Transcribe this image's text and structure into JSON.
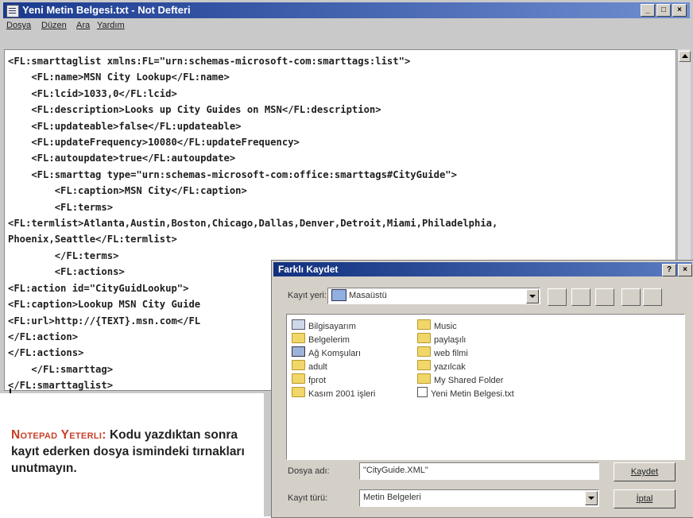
{
  "notepad": {
    "title": "Yeni Metin Belgesi.txt - Not Defteri",
    "menu": [
      "Dosya",
      "Düzen",
      "Ara",
      "Yardım"
    ],
    "code_lines": [
      "<FL:smarttaglist xmlns:FL=\"urn:schemas-microsoft-com:smarttags:list\">",
      "    <FL:name>MSN City Lookup</FL:name>",
      "    <FL:lcid>1033,0</FL:lcid>",
      "    <FL:description>Looks up City Guides on MSN</FL:description>",
      "    <FL:updateable>false</FL:updateable>",
      "    <FL:updateFrequency>10080</FL:updateFrequency>",
      "    <FL:autoupdate>true</FL:autoupdate>",
      "    <FL:smarttag type=\"urn:schemas-microsoft-com:office:smarttags#CityGuide\">",
      "        <FL:caption>MSN City</FL:caption>",
      "        <FL:terms>",
      "<FL:termlist>Atlanta,Austin,Boston,Chicago,Dallas,Denver,Detroit,Miami,Philadelphia,",
      "Phoenix,Seattle</FL:termlist>",
      "        </FL:terms>",
      "        <FL:actions>",
      "<FL:action id=\"CityGuidLookup\">",
      "<FL:caption>Lookup MSN City Guide",
      "<FL:url>http://{TEXT}.msn.com</FL",
      "</FL:action>",
      "</FL:actions>",
      "    </FL:smarttag>",
      "</FL:smarttaglist>"
    ]
  },
  "dialog": {
    "title": "Farklı Kaydet",
    "location_label": "Kayıt yeri:",
    "location_value": "Masaüstü",
    "items": [
      {
        "label": "Bilgisayarım",
        "icon": "computer-icon",
        "type": "pc"
      },
      {
        "label": "Belgelerim",
        "icon": "folder-icon",
        "type": "folder"
      },
      {
        "label": "Ağ Komşuları",
        "icon": "network-icon",
        "type": "net"
      },
      {
        "label": "adult",
        "icon": "folder-icon",
        "type": "folder"
      },
      {
        "label": "fprot",
        "icon": "folder-icon",
        "type": "folder"
      },
      {
        "label": "Kasım 2001 işleri",
        "icon": "folder-icon",
        "type": "folder"
      },
      {
        "label": "Music",
        "icon": "folder-icon",
        "type": "folder"
      },
      {
        "label": "paylaşılı",
        "icon": "folder-icon",
        "type": "folder"
      },
      {
        "label": "web filmi",
        "icon": "folder-icon",
        "type": "folder"
      },
      {
        "label": "yazılcak",
        "icon": "folder-icon",
        "type": "folder"
      },
      {
        "label": "My Shared Folder",
        "icon": "folder-icon",
        "type": "folder"
      },
      {
        "label": "Yeni Metin Belgesi.txt",
        "icon": "text-file-icon",
        "type": "txt"
      }
    ],
    "filename_label": "Dosya adı:",
    "filename_value": "\"CityGuide.XML\"",
    "filetype_label": "Kayıt türü:",
    "filetype_value": "Metin Belgeleri",
    "save_button": "Kaydet",
    "cancel_button": "İptal"
  },
  "caption": {
    "highlight": "Notepad Yeterli:",
    "text": " Kodu yazdıktan sonra kayıt ederken dosya ismindeki tırnakları unutmayın."
  }
}
